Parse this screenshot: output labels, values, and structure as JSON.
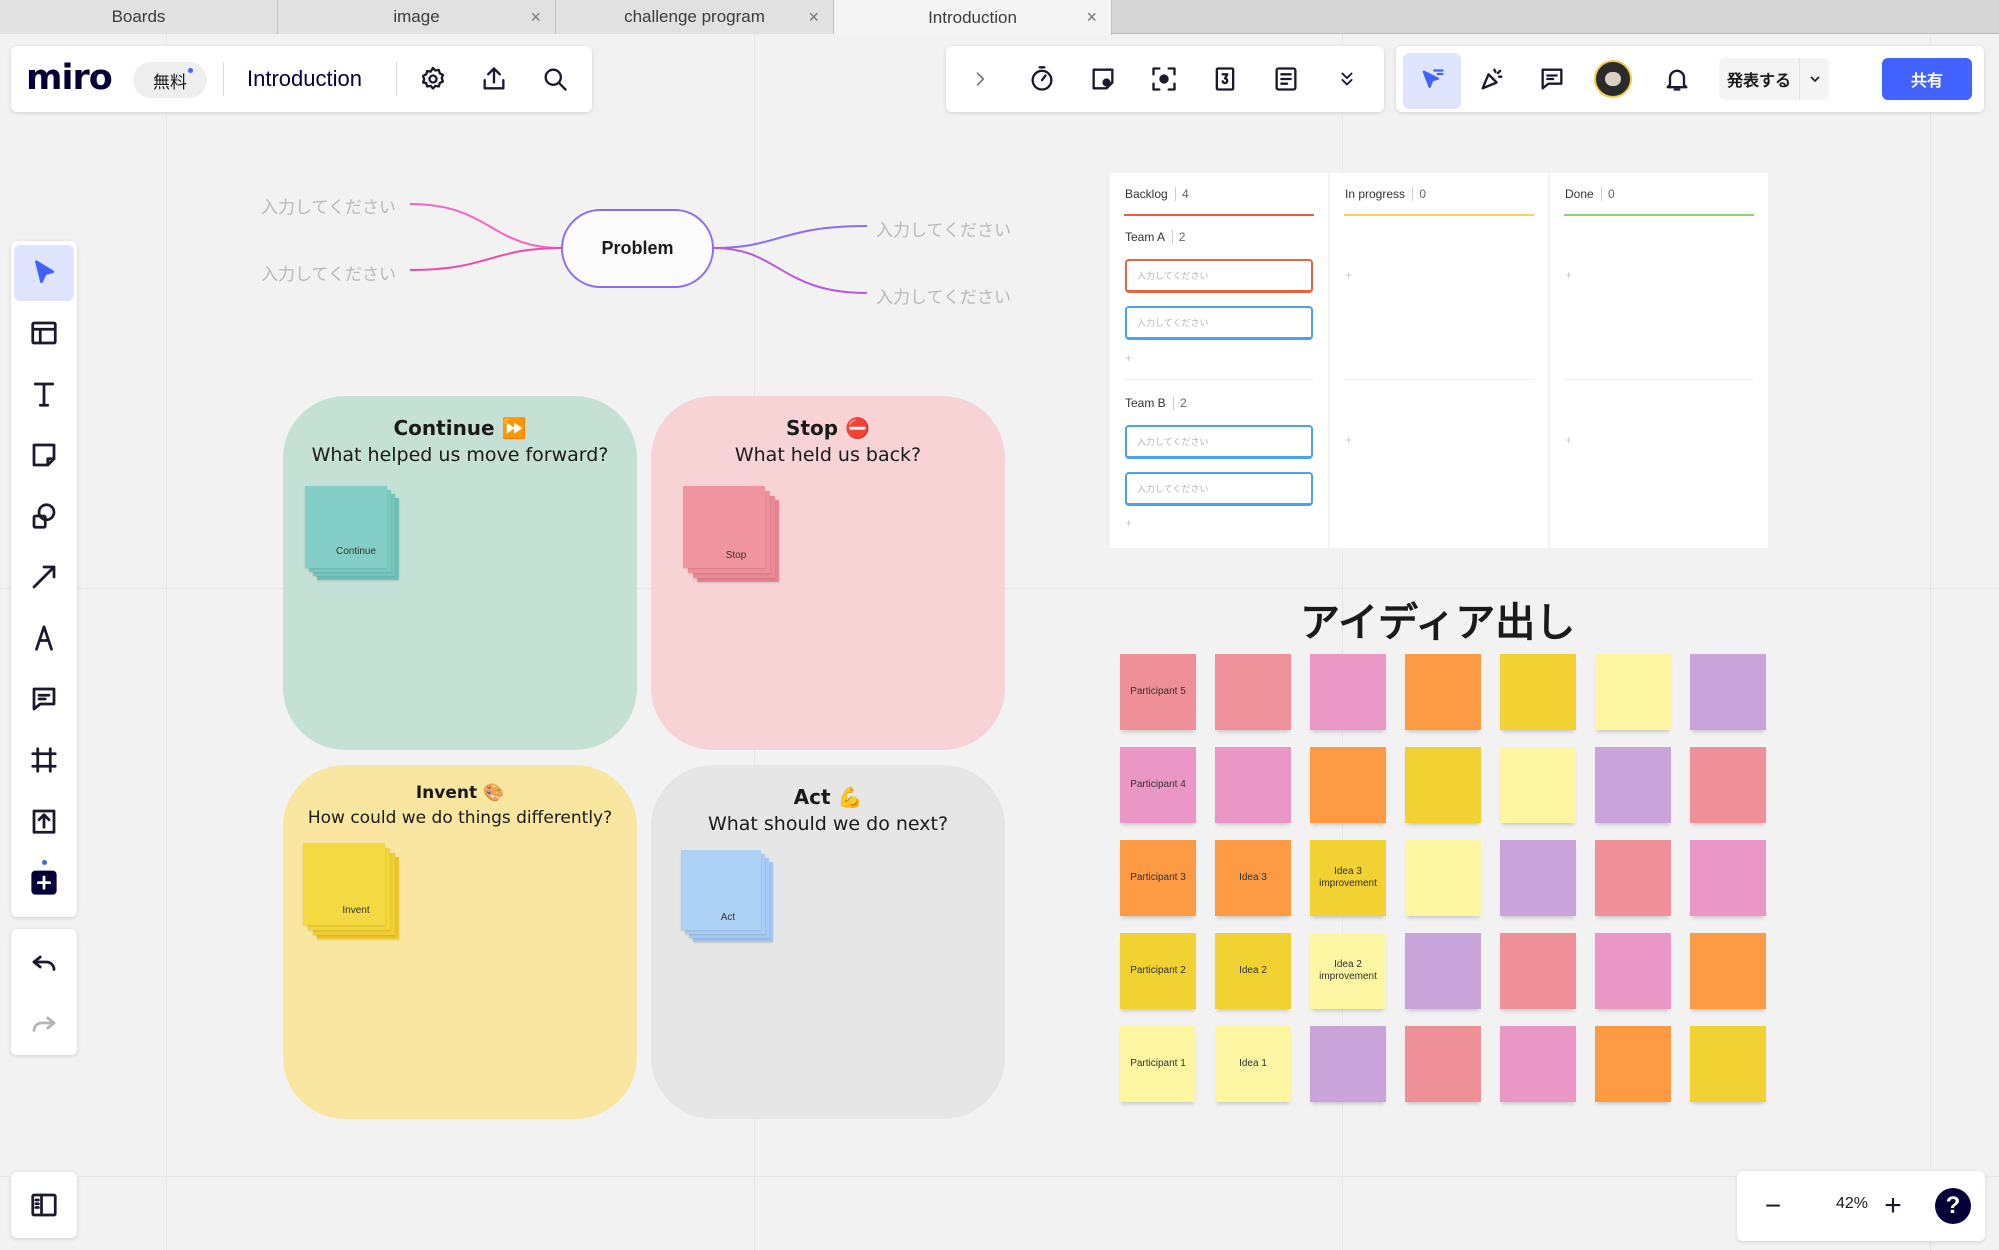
{
  "browser": {
    "tabs": [
      {
        "label": "Boards",
        "closable": false,
        "active": false
      },
      {
        "label": "image",
        "closable": true,
        "active": false
      },
      {
        "label": "challenge program",
        "closable": true,
        "active": false
      },
      {
        "label": "Introduction",
        "closable": true,
        "active": true
      }
    ],
    "close_glyph": "×"
  },
  "header": {
    "logo": "miro",
    "plan_badge": "無料",
    "board_title": "Introduction",
    "icons": [
      "settings-icon",
      "upload-icon",
      "search-icon"
    ]
  },
  "top_toolbar": {
    "icons": [
      "chevron-right-icon",
      "timer-icon",
      "sticky-add-icon",
      "focus-icon",
      "voting-icon",
      "notes-icon",
      "chevrons-down-icon"
    ]
  },
  "collab_toolbar": {
    "icons": [
      "cursor-follow-icon",
      "reactions-icon",
      "comment-icon",
      "avatar",
      "bell-icon"
    ],
    "present_label": "発表する",
    "share_label": "共有",
    "accent": "#4262ff"
  },
  "left_toolbar": {
    "tools": [
      "select-tool",
      "templates-tool",
      "text-tool",
      "sticky-note-tool",
      "shapes-tool",
      "connector-tool",
      "pen-tool",
      "comment-tool",
      "frame-tool",
      "upload-tool",
      "more-apps-tool"
    ],
    "history": [
      "undo-button",
      "redo-button"
    ]
  },
  "mind_map": {
    "root": "Problem",
    "left_children": [
      "入力してください",
      "入力してください"
    ],
    "right_children": [
      "入力してください",
      "入力してください"
    ]
  },
  "retro": {
    "quadrants": [
      {
        "title": "Continue ⏩",
        "subtitle": "What helped us move forward?",
        "stack_label": "Continue",
        "bg": "#c5e1d6",
        "note": "#7dcac3"
      },
      {
        "title": "Stop ⛔",
        "subtitle": "What held us back?",
        "stack_label": "Stop",
        "bg": "#f7d3d6",
        "note": "#ee8f9b"
      },
      {
        "title": "Invent 🎨",
        "subtitle": "How could we do things differently?",
        "stack_label": "Invent",
        "bg": "#f8e6a1",
        "note": "#f2d53a"
      },
      {
        "title": "Act 💪",
        "subtitle": "What should we do next?",
        "stack_label": "Act",
        "bg": "#e6e6e6",
        "note": "#a9cdf5"
      }
    ]
  },
  "kanban": {
    "columns": [
      {
        "name": "Backlog",
        "count": "4",
        "color": "#ef5b3c"
      },
      {
        "name": "In progress",
        "count": "0",
        "color": "#f4d35e"
      },
      {
        "name": "Done",
        "count": "0",
        "color": "#8fd46a"
      }
    ],
    "lanes": [
      {
        "name": "Team A",
        "count": "2",
        "cards": [
          {
            "text": "入力してください",
            "border": "#e5643f"
          },
          {
            "text": "入力してください",
            "border": "#4aa3e8"
          }
        ]
      },
      {
        "name": "Team B",
        "count": "2",
        "cards": [
          {
            "text": "入力してください",
            "border": "#4aa3e8"
          },
          {
            "text": "入力してください",
            "border": "#4aa3e8"
          }
        ]
      }
    ],
    "add_glyph": "+"
  },
  "ideation": {
    "title": "アイディア出し",
    "grid": [
      [
        {
          "text": "Participant 5",
          "color": "#ef8f98"
        },
        {
          "text": "",
          "color": "#ef929c"
        },
        {
          "text": "",
          "color": "#ec98c6"
        },
        {
          "text": "",
          "color": "#fd9a44"
        },
        {
          "text": "",
          "color": "#f2d132"
        },
        {
          "text": "",
          "color": "#fcf5a2"
        },
        {
          "text": "",
          "color": "#c8a4da"
        }
      ],
      [
        {
          "text": "Participant 4",
          "color": "#eb97c5"
        },
        {
          "text": "",
          "color": "#eb97c5"
        },
        {
          "text": "",
          "color": "#fd9a44"
        },
        {
          "text": "",
          "color": "#f2d132"
        },
        {
          "text": "",
          "color": "#fcf5a2"
        },
        {
          "text": "",
          "color": "#c8a4da"
        },
        {
          "text": "",
          "color": "#ef8f98"
        }
      ],
      [
        {
          "text": "Participant 3",
          "color": "#fd9a44"
        },
        {
          "text": "Idea 3",
          "color": "#fd9a44"
        },
        {
          "text": "Idea 3 improvement",
          "color": "#f2d132"
        },
        {
          "text": "",
          "color": "#fcf5a2"
        },
        {
          "text": "",
          "color": "#c8a4da"
        },
        {
          "text": "",
          "color": "#ef8f98"
        },
        {
          "text": "",
          "color": "#eb97c5"
        }
      ],
      [
        {
          "text": "Participant 2",
          "color": "#f2d132"
        },
        {
          "text": "Idea 2",
          "color": "#f2d132"
        },
        {
          "text": "Idea 2 improvement",
          "color": "#fcf5a2"
        },
        {
          "text": "",
          "color": "#c8a4da"
        },
        {
          "text": "",
          "color": "#ef8f98"
        },
        {
          "text": "",
          "color": "#eb97c5"
        },
        {
          "text": "",
          "color": "#fd9a44"
        }
      ],
      [
        {
          "text": "Participant 1",
          "color": "#fcf5a2"
        },
        {
          "text": "Idea 1",
          "color": "#fcf5a2"
        },
        {
          "text": "",
          "color": "#c8a4da"
        },
        {
          "text": "",
          "color": "#ef8f98"
        },
        {
          "text": "",
          "color": "#eb97c5"
        },
        {
          "text": "",
          "color": "#fd9a44"
        },
        {
          "text": "",
          "color": "#f2d132"
        }
      ]
    ]
  },
  "zoom": {
    "value": "42%",
    "minus": "−",
    "plus": "+",
    "help": "?"
  }
}
